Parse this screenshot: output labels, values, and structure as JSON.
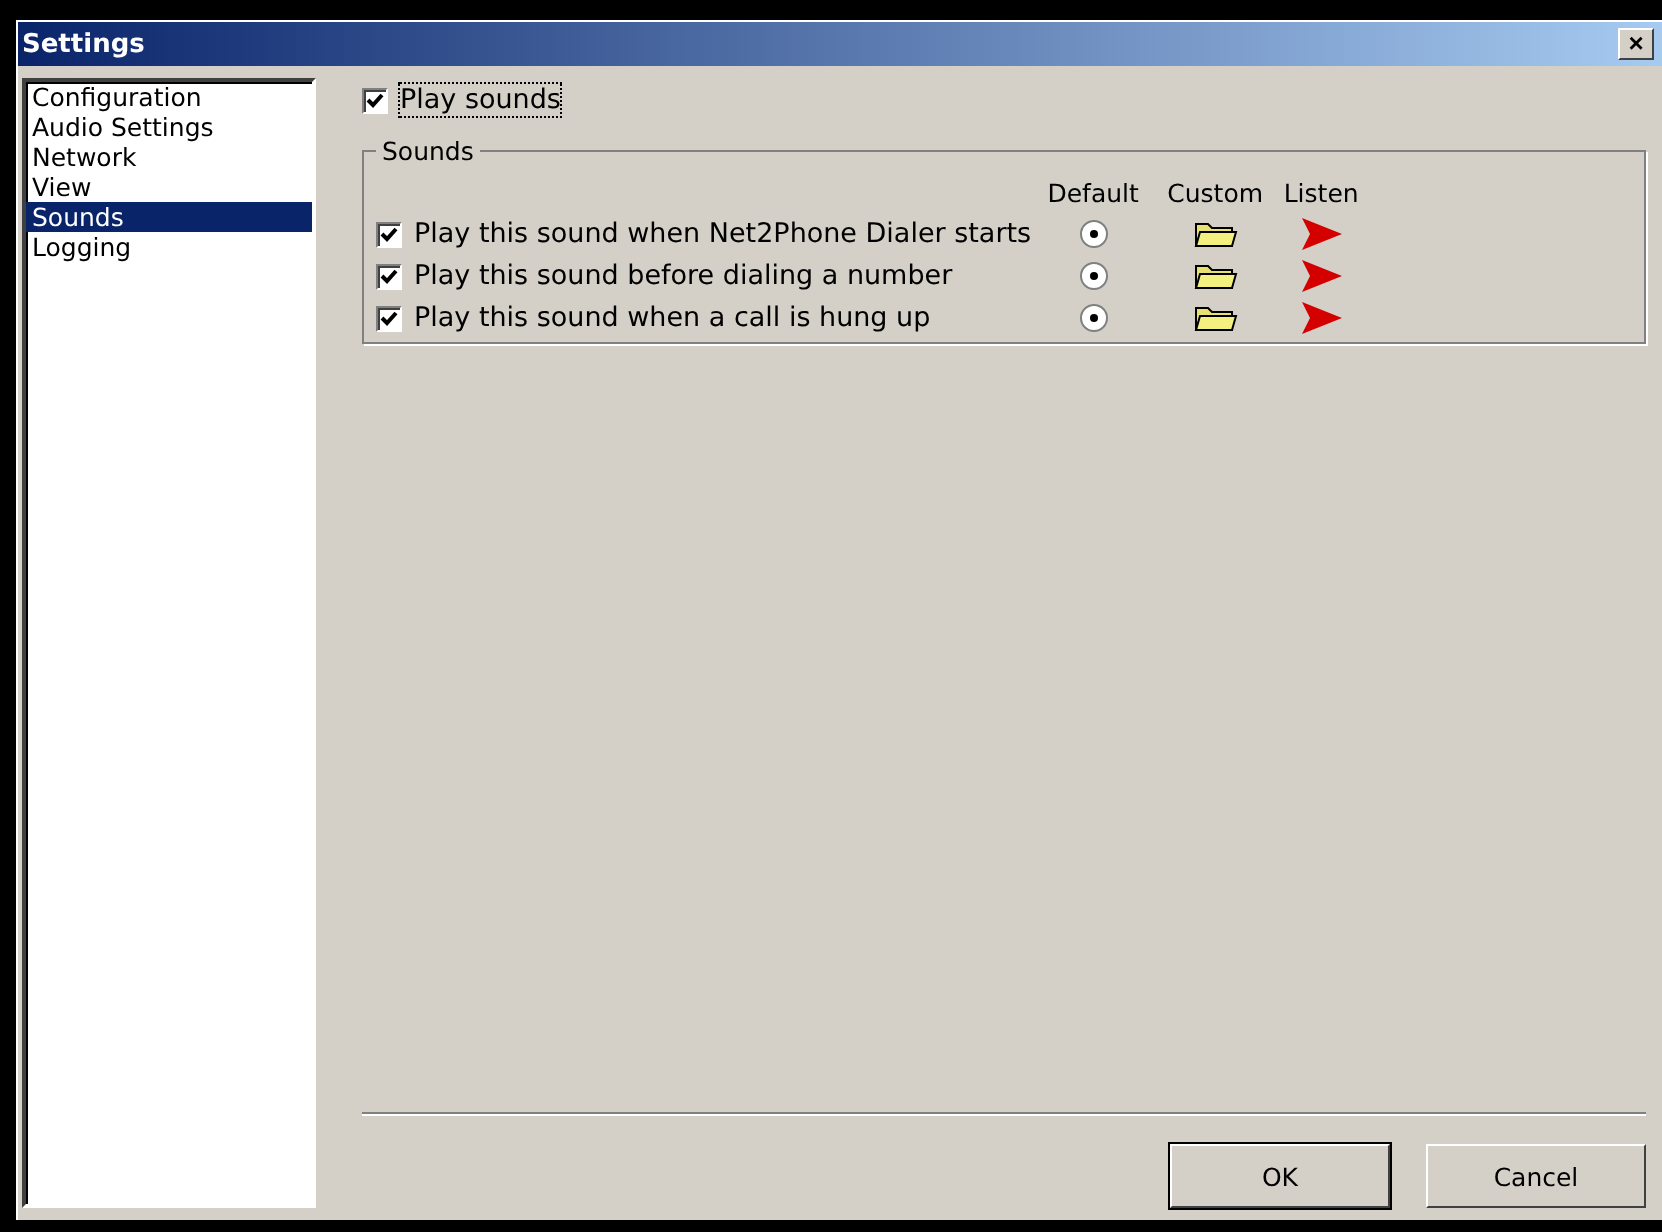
{
  "window": {
    "title": "Settings",
    "close_label": "×"
  },
  "sidebar": {
    "items": [
      {
        "label": "Configuration",
        "selected": false
      },
      {
        "label": "Audio Settings",
        "selected": false
      },
      {
        "label": "Network",
        "selected": false
      },
      {
        "label": "View",
        "selected": false
      },
      {
        "label": "Sounds",
        "selected": true
      },
      {
        "label": "Logging",
        "selected": false
      }
    ]
  },
  "play_sounds": {
    "label": "Play sounds",
    "checked": true
  },
  "sounds_group": {
    "title": "Sounds",
    "columns": [
      "Default",
      "Custom",
      "Listen"
    ],
    "rows": [
      {
        "label": "Play this sound when Net2Phone Dialer starts",
        "checked": true,
        "default_selected": true
      },
      {
        "label": "Play this sound before dialing a number",
        "checked": true,
        "default_selected": true
      },
      {
        "label": "Play this sound when a call is hung up",
        "checked": true,
        "default_selected": true
      }
    ]
  },
  "buttons": [
    {
      "label": "OK",
      "default": true
    },
    {
      "label": "Cancel",
      "default": false
    }
  ]
}
